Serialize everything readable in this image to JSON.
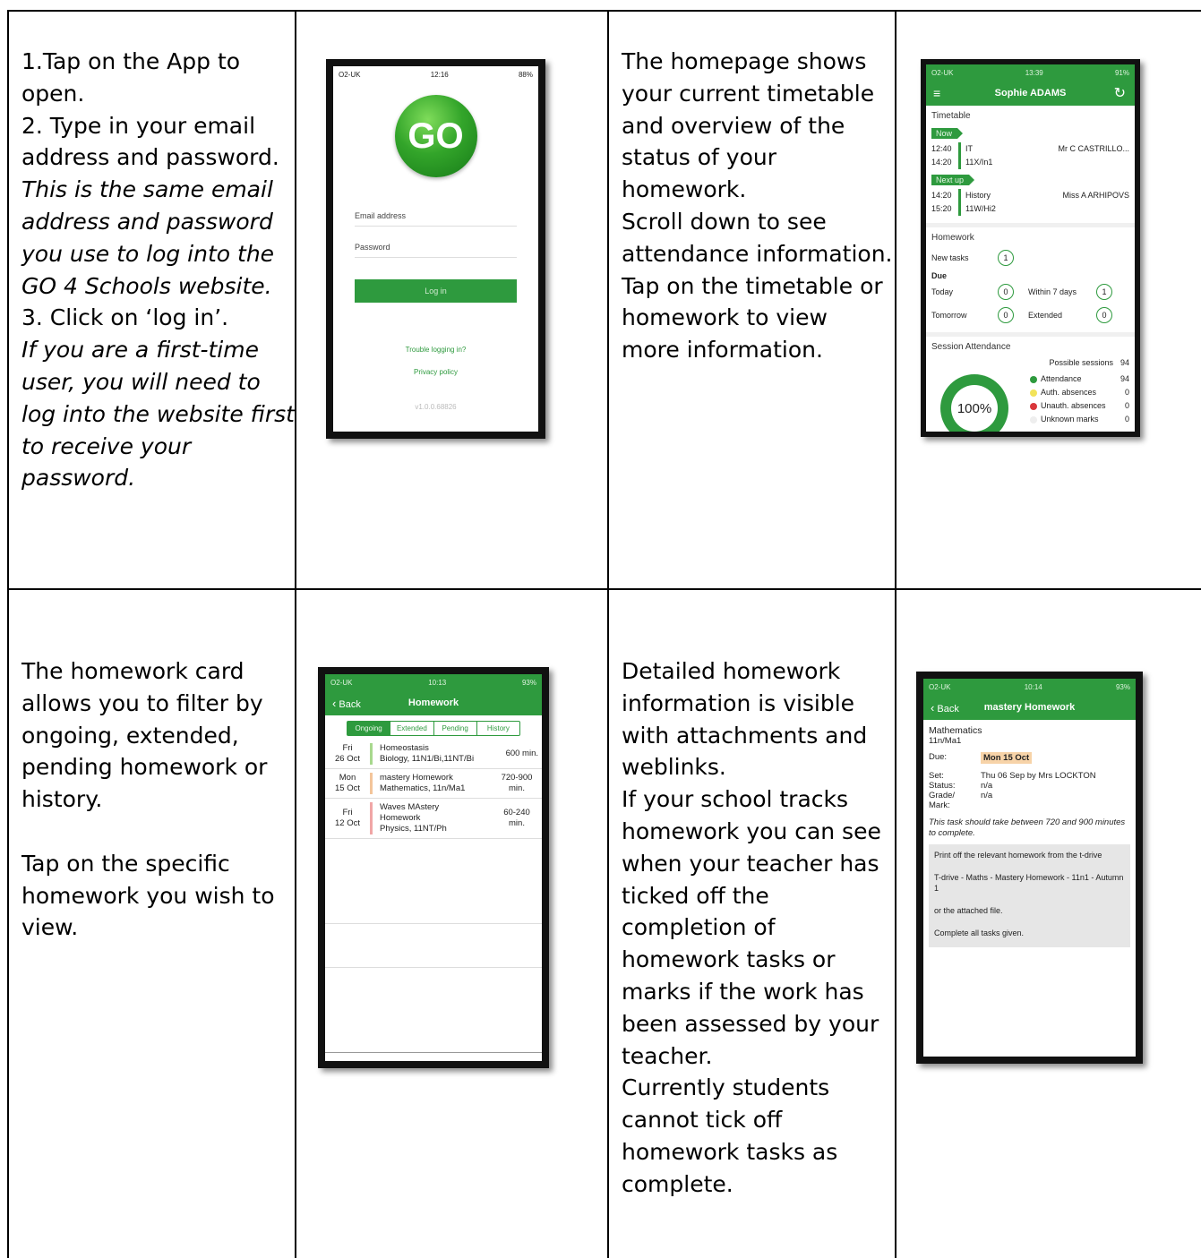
{
  "cells": {
    "c1": {
      "line1": "1.Tap on the App to",
      "line2": "open.",
      "line3": "2. Type in your email",
      "line4": "address and password.",
      "it1": "This is the same email",
      "it2": "address and password",
      "it3": "you use to log into the",
      "it4": "GO 4 Schools website.",
      "line5": "3. Click on ‘log in’.",
      "it5": "If you are a first-time",
      "it6": "user, you will need to",
      "it7": "log into the website first",
      "it8": "to receive your",
      "it9": "password."
    },
    "c2": {
      "l1": "The homepage shows",
      "l2": "your current timetable",
      "l3": "and overview of the",
      "l4": "status of your",
      "l5": "homework.",
      "l6": "Scroll down to see",
      "l7": "attendance information.",
      "l8": "Tap on the timetable or",
      "l9": "homework to view",
      "l10": "more information."
    },
    "c3": {
      "l1": "The homework card",
      "l2": "allows you to filter by",
      "l3": "ongoing, extended,",
      "l4": "pending homework or",
      "l5": "history.",
      "l6": "Tap on the specific",
      "l7": "homework you wish to",
      "l8": "view."
    },
    "c4": {
      "l1": "Detailed homework",
      "l2": "information is visible",
      "l3": "with attachments and",
      "l4": "weblinks.",
      "l5": "If your school tracks",
      "l6": "homework you can see",
      "l7": "when your teacher has",
      "l8": "ticked off the",
      "l9": "completion of",
      "l10": "homework tasks or",
      "l11": "marks if the work has",
      "l12": "been assessed by your",
      "l13": "teacher.",
      "l14": "Currently students",
      "l15": "cannot tick off",
      "l16": "homework tasks as",
      "l17": "complete."
    }
  },
  "phone_login": {
    "status_left": "O2-UK",
    "status_time": "12:16",
    "status_right": "88%",
    "logo_text": "GO",
    "email_label": "Email address",
    "password_label": "Password",
    "login_button": "Log in",
    "trouble_link": "Trouble logging in?",
    "privacy_link": "Privacy policy",
    "version": "v1.0.0.68826"
  },
  "phone_home": {
    "status_left": "O2-UK",
    "status_time": "13:39",
    "status_right": "91%",
    "title": "Sophie ADAMS",
    "timetable_title": "Timetable",
    "now_tag": "Now",
    "now_start": "12:40",
    "now_end": "14:20",
    "now_subject": "IT",
    "now_class": "11X/In1",
    "now_teacher": "Mr C CASTRILLO...",
    "next_tag": "Next up",
    "next_start": "14:20",
    "next_end": "15:20",
    "next_subject": "History",
    "next_class": "11W/Hi2",
    "next_teacher": "Miss A ARHIPOVS",
    "homework_title": "Homework",
    "new_tasks_label": "New tasks",
    "new_tasks": "1",
    "due_label": "Due",
    "today_label": "Today",
    "today": "0",
    "within7_label": "Within 7 days",
    "within7": "1",
    "tomorrow_label": "Tomorrow",
    "tomorrow": "0",
    "extended_label": "Extended",
    "extended": "0",
    "attendance_title": "Session Attendance",
    "possible_label": "Possible sessions",
    "possible": "94",
    "attendance_label": "Attendance",
    "attendance": "94",
    "auth_label": "Auth. absences",
    "auth": "0",
    "unauth_label": "Unauth. absences",
    "unauth": "0",
    "unknown_label": "Unknown marks",
    "unknown": "0",
    "percent": "100%",
    "colors": {
      "green": "#2e9a3e",
      "yellow": "#f2e35a",
      "red": "#d9373b"
    }
  },
  "phone_hwlist": {
    "status_left": "O2-UK",
    "status_time": "10:13",
    "status_right": "93%",
    "back": "Back",
    "title": "Homework",
    "tabs": [
      "Ongoing",
      "Extended",
      "Pending",
      "History"
    ],
    "items": [
      {
        "day": "Fri",
        "date": "26 Oct",
        "title": "Homeostasis",
        "sub": "Biology, 11N1/Bi,11NT/Bi",
        "dur1": "600 min.",
        "dur2": "",
        "color": "#a8d88e"
      },
      {
        "day": "Mon",
        "date": "15 Oct",
        "title": "mastery Homework",
        "sub": "Mathematics, 11n/Ma1",
        "dur1": "720-900",
        "dur2": "min.",
        "color": "#f3c59a"
      },
      {
        "day": "Fri",
        "date": "12 Oct",
        "title": "Waves MAstery",
        "title2": "Homework",
        "sub": "Physics, 11NT/Ph",
        "dur1": "60-240",
        "dur2": "min.",
        "color": "#f0a6a6"
      }
    ]
  },
  "phone_detail": {
    "status_left": "O2-UK",
    "status_time": "10:14",
    "status_right": "93%",
    "back": "Back",
    "title": "mastery Homework",
    "subject": "Mathematics",
    "group": "11n/Ma1",
    "due_label": "Due:",
    "due": "Mon 15 Oct",
    "set_label": "Set:",
    "set": "Thu 06 Sep by Mrs LOCKTON",
    "status_label": "Status:",
    "status": "n/a",
    "grade_label": "Grade/",
    "grade_label2": "Mark:",
    "grade": "n/a",
    "note": "This task should take between 720 and 900 minutes to complete.",
    "p1": "Print off the relevant homework from the t-drive",
    "p2": "T-drive - Maths - Mastery Homework - 11n1 - Autumn 1",
    "p3": "or the attached file.",
    "p4": "Complete all tasks given."
  }
}
